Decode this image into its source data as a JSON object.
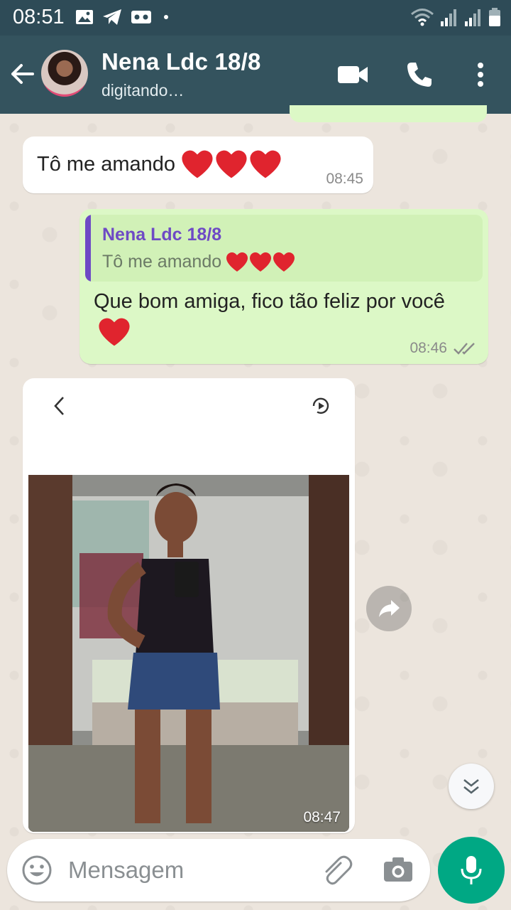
{
  "status_bar": {
    "time": "08:51",
    "icons": [
      "gallery-icon",
      "telegram-icon",
      "voicemail-icon",
      "dot-icon",
      "wifi-icon",
      "signal-icon",
      "signal-icon",
      "battery-icon"
    ]
  },
  "header": {
    "contact_name": "Nena Ldc 18/8",
    "contact_status": "digitando…",
    "actions": [
      "back-arrow-icon",
      "video-call-icon",
      "voice-call-icon",
      "more-options-icon"
    ]
  },
  "messages": [
    {
      "direction": "incoming",
      "text": "Tô me  amando",
      "emoji": "❤️❤️❤️",
      "time": "08:45"
    },
    {
      "direction": "outgoing",
      "quote": {
        "author": "Nena Ldc 18/8",
        "text": "Tô me  amando",
        "emoji": "❤️❤️❤️"
      },
      "text": "Que bom amiga, fico tão feliz por você",
      "emoji": "❤️",
      "time": "08:46",
      "status": "read-double-check"
    },
    {
      "direction": "incoming",
      "type": "image",
      "time": "08:47"
    }
  ],
  "composer": {
    "placeholder": "Mensagem"
  },
  "colors": {
    "header_bg": "#34535e",
    "status_bg": "#2e4b57",
    "outgoing_bubble": "#dcf8c6",
    "incoming_bubble": "#ffffff",
    "quote_author": "#6e4ac5",
    "read_ticks": "#8a8a8a",
    "mic_button": "#00a884"
  }
}
